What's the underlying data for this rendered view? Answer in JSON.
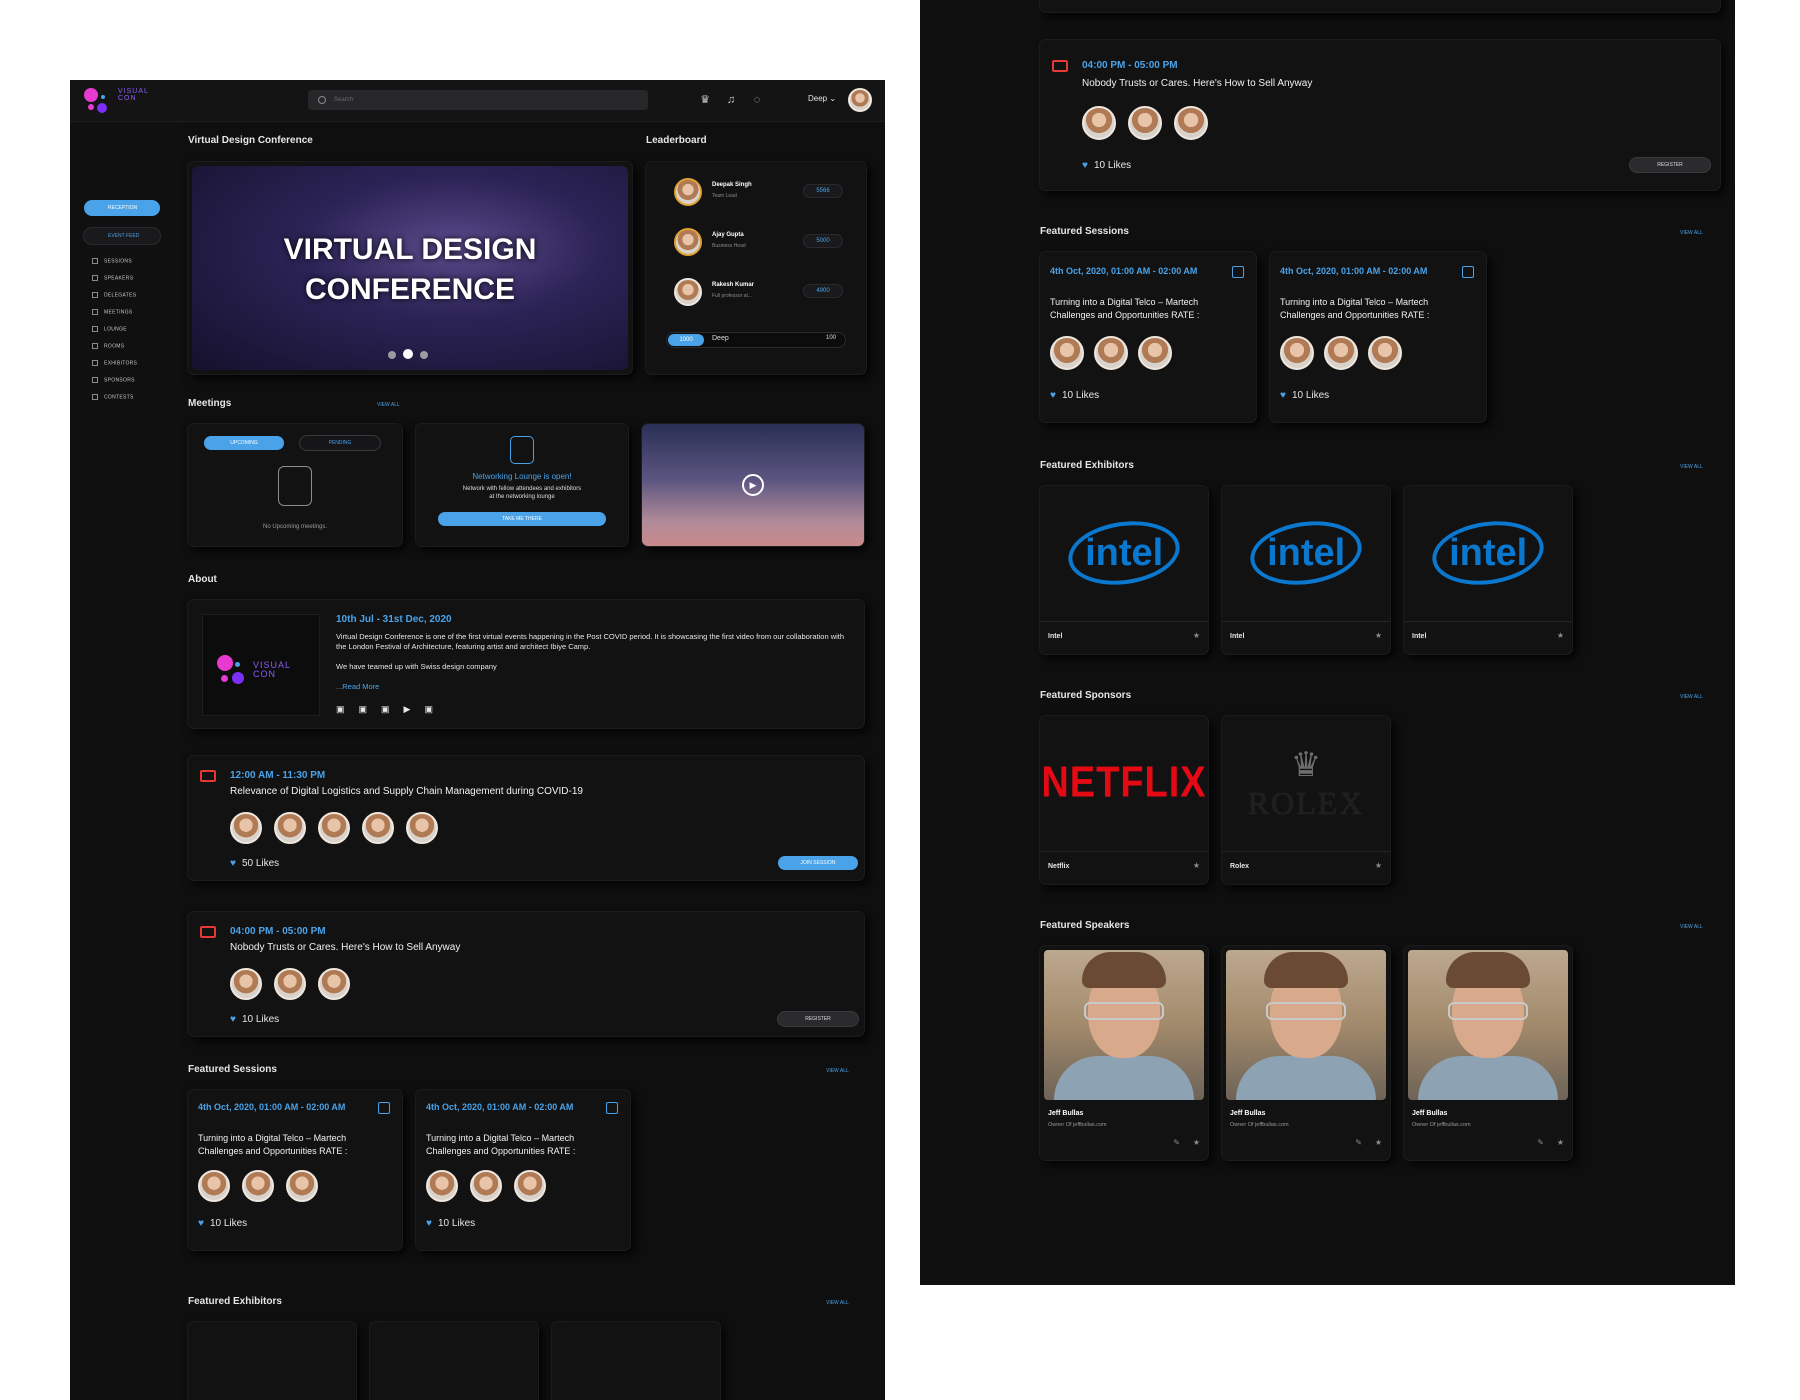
{
  "header": {
    "logo_text": "VISUAL CON",
    "search_placeholder": "Search",
    "user_name": "Deep"
  },
  "sidebar": {
    "active_item": "RECEPTION",
    "secondary_item": "EVENT FEED",
    "items": [
      "SESSIONS",
      "SPEAKERS",
      "DELEGATES",
      "MEETINGS",
      "LOUNGE",
      "ROOMS",
      "EXHIBITORS",
      "SPONSORS",
      "CONTESTS"
    ]
  },
  "conference": {
    "section_title": "Virtual Design Conference",
    "banner_line1": "VIRTUAL DESIGN",
    "banner_line2": "CONFERENCE"
  },
  "leaderboard": {
    "title": "Leaderboard",
    "entries": [
      {
        "name": "Deepak Singh",
        "role": "Team Lead",
        "score": "5566"
      },
      {
        "name": "Ajay Gupta",
        "role": "Business Head",
        "score": "5000"
      },
      {
        "name": "Rakesh Kumar",
        "role": "Full professor at...",
        "score": "4900"
      }
    ],
    "me": {
      "score": "1000",
      "name": "Deep",
      "rank": "100"
    }
  },
  "meetings": {
    "title": "Meetings",
    "view_all": "VIEW ALL",
    "tab_upcoming": "UPCOMING",
    "tab_pending": "PENDING",
    "empty_text": "No Upcoming meetings.",
    "lounge_title": "Networking Lounge is open!",
    "lounge_desc1": "Network with fellow attendees and exhibitors",
    "lounge_desc2": "at the networking lounge",
    "lounge_button": "TAKE ME THERE"
  },
  "about": {
    "title": "About",
    "date": "10th Jul - 31st Dec, 2020",
    "para1": "Virtual Design Conference is one of the first virtual events happening in the Post COVID period. It is showcasing the first video from our collaboration with the London Festival of Architecture, featuring artist and architect Ibiye Camp.",
    "para2": "We have teamed up with Swiss design company",
    "read_more": "...Read More"
  },
  "sessions": [
    {
      "time": "12:00 AM - 11:30 PM",
      "title": "Relevance of Digital Logistics and Supply Chain Management during COVID-19",
      "likes": "50 Likes",
      "button": "JOIN SESSION"
    },
    {
      "time": "04:00 PM - 05:00 PM",
      "title": "Nobody Trusts or Cares. Here's How to Sell Anyway",
      "likes": "10 Likes",
      "button": "REGISTER"
    }
  ],
  "featured_sessions": {
    "title": "Featured Sessions",
    "view_all": "VIEW ALL",
    "items": [
      {
        "date": "4th Oct, 2020, 01:00 AM - 02:00 AM",
        "line1": "Turning into a Digital Telco – Martech",
        "line2": "Challenges and Opportunities RATE :",
        "likes": "10 Likes"
      },
      {
        "date": "4th Oct, 2020, 01:00 AM - 02:00 AM",
        "line1": "Turning into a Digital Telco – Martech",
        "line2": "Challenges and Opportunities RATE :",
        "likes": "10 Likes"
      }
    ]
  },
  "featured_exhibitors": {
    "title": "Featured Exhibitors",
    "view_all": "VIEW ALL",
    "items": [
      {
        "name": "Intel",
        "logo": "intel"
      },
      {
        "name": "Intel",
        "logo": "intel"
      },
      {
        "name": "Intel",
        "logo": "intel"
      }
    ]
  },
  "featured_sponsors": {
    "title": "Featured Sponsors",
    "view_all": "VIEW ALL",
    "items": [
      {
        "name": "Netflix",
        "logo": "NETFLIX"
      },
      {
        "name": "Rolex",
        "logo": "ROLEX"
      }
    ]
  },
  "featured_speakers": {
    "title": "Featured Speakers",
    "view_all": "VIEW ALL",
    "items": [
      {
        "name": "Jeff Bullas",
        "role": "Owner Of jeffbullas.com"
      },
      {
        "name": "Jeff Bullas",
        "role": "Owner Of jeffbullas.com"
      },
      {
        "name": "Jeff Bullas",
        "role": "Owner Of jeffbullas.com"
      }
    ]
  },
  "colors": {
    "accent": "#4aa3e8",
    "bg": "#0f0f10",
    "card": "#121213",
    "danger": "#e53935",
    "logo_pink": "#e83ad0",
    "logo_purple": "#7b2ff7"
  }
}
